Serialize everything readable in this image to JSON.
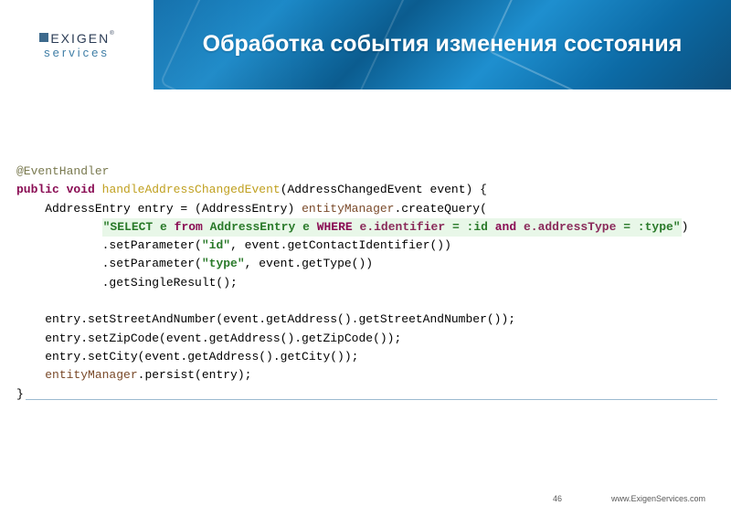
{
  "logo": {
    "main": "EXIGEN",
    "reg": "®",
    "sub": "services"
  },
  "title": "Обработка события изменения состояния",
  "code": {
    "l1_ann": "@EventHandler",
    "l2_kw": "public void",
    "l2_fn": "handleAddressChangedEvent",
    "l2_rest": "(AddressChangedEvent event) {",
    "l3_a": "    AddressEntry entry = (AddressEntry) ",
    "l3_em": "entityManager",
    "l3_b": ".createQuery(",
    "l4_pad": "            ",
    "l4_q1": "\"SELECT",
    "l4_s1": " e ",
    "l4_q2": "from",
    "l4_s2": " AddressEntry e ",
    "l4_q3": "WHERE",
    "l4_s3": " ",
    "l4_id1": "e.identifier",
    "l4_s4": " = :id ",
    "l4_q4": "and",
    "l4_s5": " ",
    "l4_id2": "e.addressType",
    "l4_s6": " = :type\"",
    "l4_end": ")",
    "l5_a": "            .setParameter(",
    "l5_s": "\"id\"",
    "l5_b": ", event.getContactIdentifier())",
    "l6_a": "            .setParameter(",
    "l6_s": "\"type\"",
    "l6_b": ", event.getType())",
    "l7": "            .getSingleResult();",
    "l8_blank": " ",
    "l9": "    entry.setStreetAndNumber(event.getAddress().getStreetAndNumber());",
    "l10": "    entry.setZipCode(event.getAddress().getZipCode());",
    "l11": "    entry.setCity(event.getAddress().getCity());",
    "l12_pad": "    ",
    "l12_em": "entityManager",
    "l12_b": ".persist(entry);",
    "l13": "}"
  },
  "footer": {
    "page": "46",
    "url": "www.ExigenServices.com"
  }
}
